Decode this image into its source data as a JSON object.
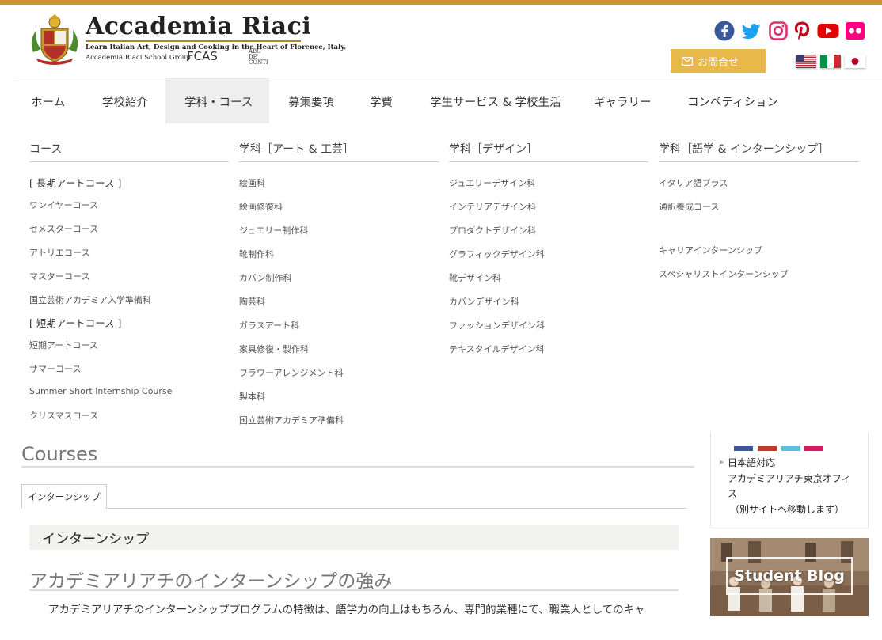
{
  "header": {
    "logo_title": "Accademia Riaci",
    "logo_tagline": "Learn Italian Art, Design and Cooking in the Heart of Florence, Italy.",
    "logo_group": "Accademia Riaci School Group",
    "logo_fcas": "FCAS",
    "logo_abc": "ABC DE' CONTI",
    "contact_label": "お問合せ",
    "social": [
      "facebook-icon",
      "twitter-icon",
      "instagram-icon",
      "pinterest-icon",
      "youtube-icon",
      "flickr-icon"
    ],
    "flags": [
      "us-flag",
      "italy-flag",
      "japan-flag"
    ],
    "colors": {
      "accent": "#c8962e",
      "contact_button": "#e8b84a"
    }
  },
  "nav": {
    "items": [
      {
        "label": "ホーム"
      },
      {
        "label": "学校紹介"
      },
      {
        "label": "学科・コース",
        "active": true
      },
      {
        "label": "募集要項"
      },
      {
        "label": "学費"
      },
      {
        "label": "学生サービス & 学校生活"
      },
      {
        "label": "ギャラリー"
      },
      {
        "label": "コンペティション"
      }
    ]
  },
  "mega_menu": {
    "columns": [
      {
        "heading": "コース",
        "items": [
          "[ 長期アートコース ]",
          "ワンイヤーコース",
          "セメスターコース",
          "アトリエコース",
          "マスターコース",
          "国立芸術アカデミア入学準備科",
          "[ 短期アートコース ]",
          "短期アートコース",
          "サマーコース",
          "Summer Short Internship Course",
          "クリスマスコース"
        ]
      },
      {
        "heading": "学科［アート & 工芸］",
        "items": [
          "絵画科",
          "絵画修復科",
          "ジュエリー制作科",
          "靴制作科",
          "カバン制作科",
          "陶芸科",
          "ガラスアート科",
          "家具修復・製作科",
          "フラワーアレンジメント科",
          "製本科",
          "国立芸術アカデミア準備科"
        ]
      },
      {
        "heading": "学科［デザイン］",
        "items": [
          "ジュエリーデザイン科",
          "インテリアデザイン科",
          "プロダクトデザイン科",
          "グラフィックデザイン科",
          "靴デザイン科",
          "カバンデザイン科",
          "ファッションデザイン科",
          "テキスタイルデザイン科"
        ]
      },
      {
        "heading": "学科［語学 & インターンシップ］",
        "items": [
          "イタリア語プラス",
          "通訳養成コース",
          "キャリアインターンシップ",
          "スペシャリストインターンシップ"
        ]
      }
    ]
  },
  "main": {
    "courses_title": "Courses",
    "tab_label": "インターンシップ",
    "section_heading": "インターンシップ",
    "h2": "アカデミアリアチのインターンシップの強み",
    "paragraph": "アカデミアリアチのインターンシッププログラムの特徴は、語学力の向上はもちろん、専門的業種にて、職業人としてのキャ"
  },
  "sidebar": {
    "lines": [
      "日本語対応",
      "アカデミアリアチ東京オフィ",
      "ス",
      "（別サイトへ移動します）"
    ],
    "blog_label": "Student Blog"
  }
}
